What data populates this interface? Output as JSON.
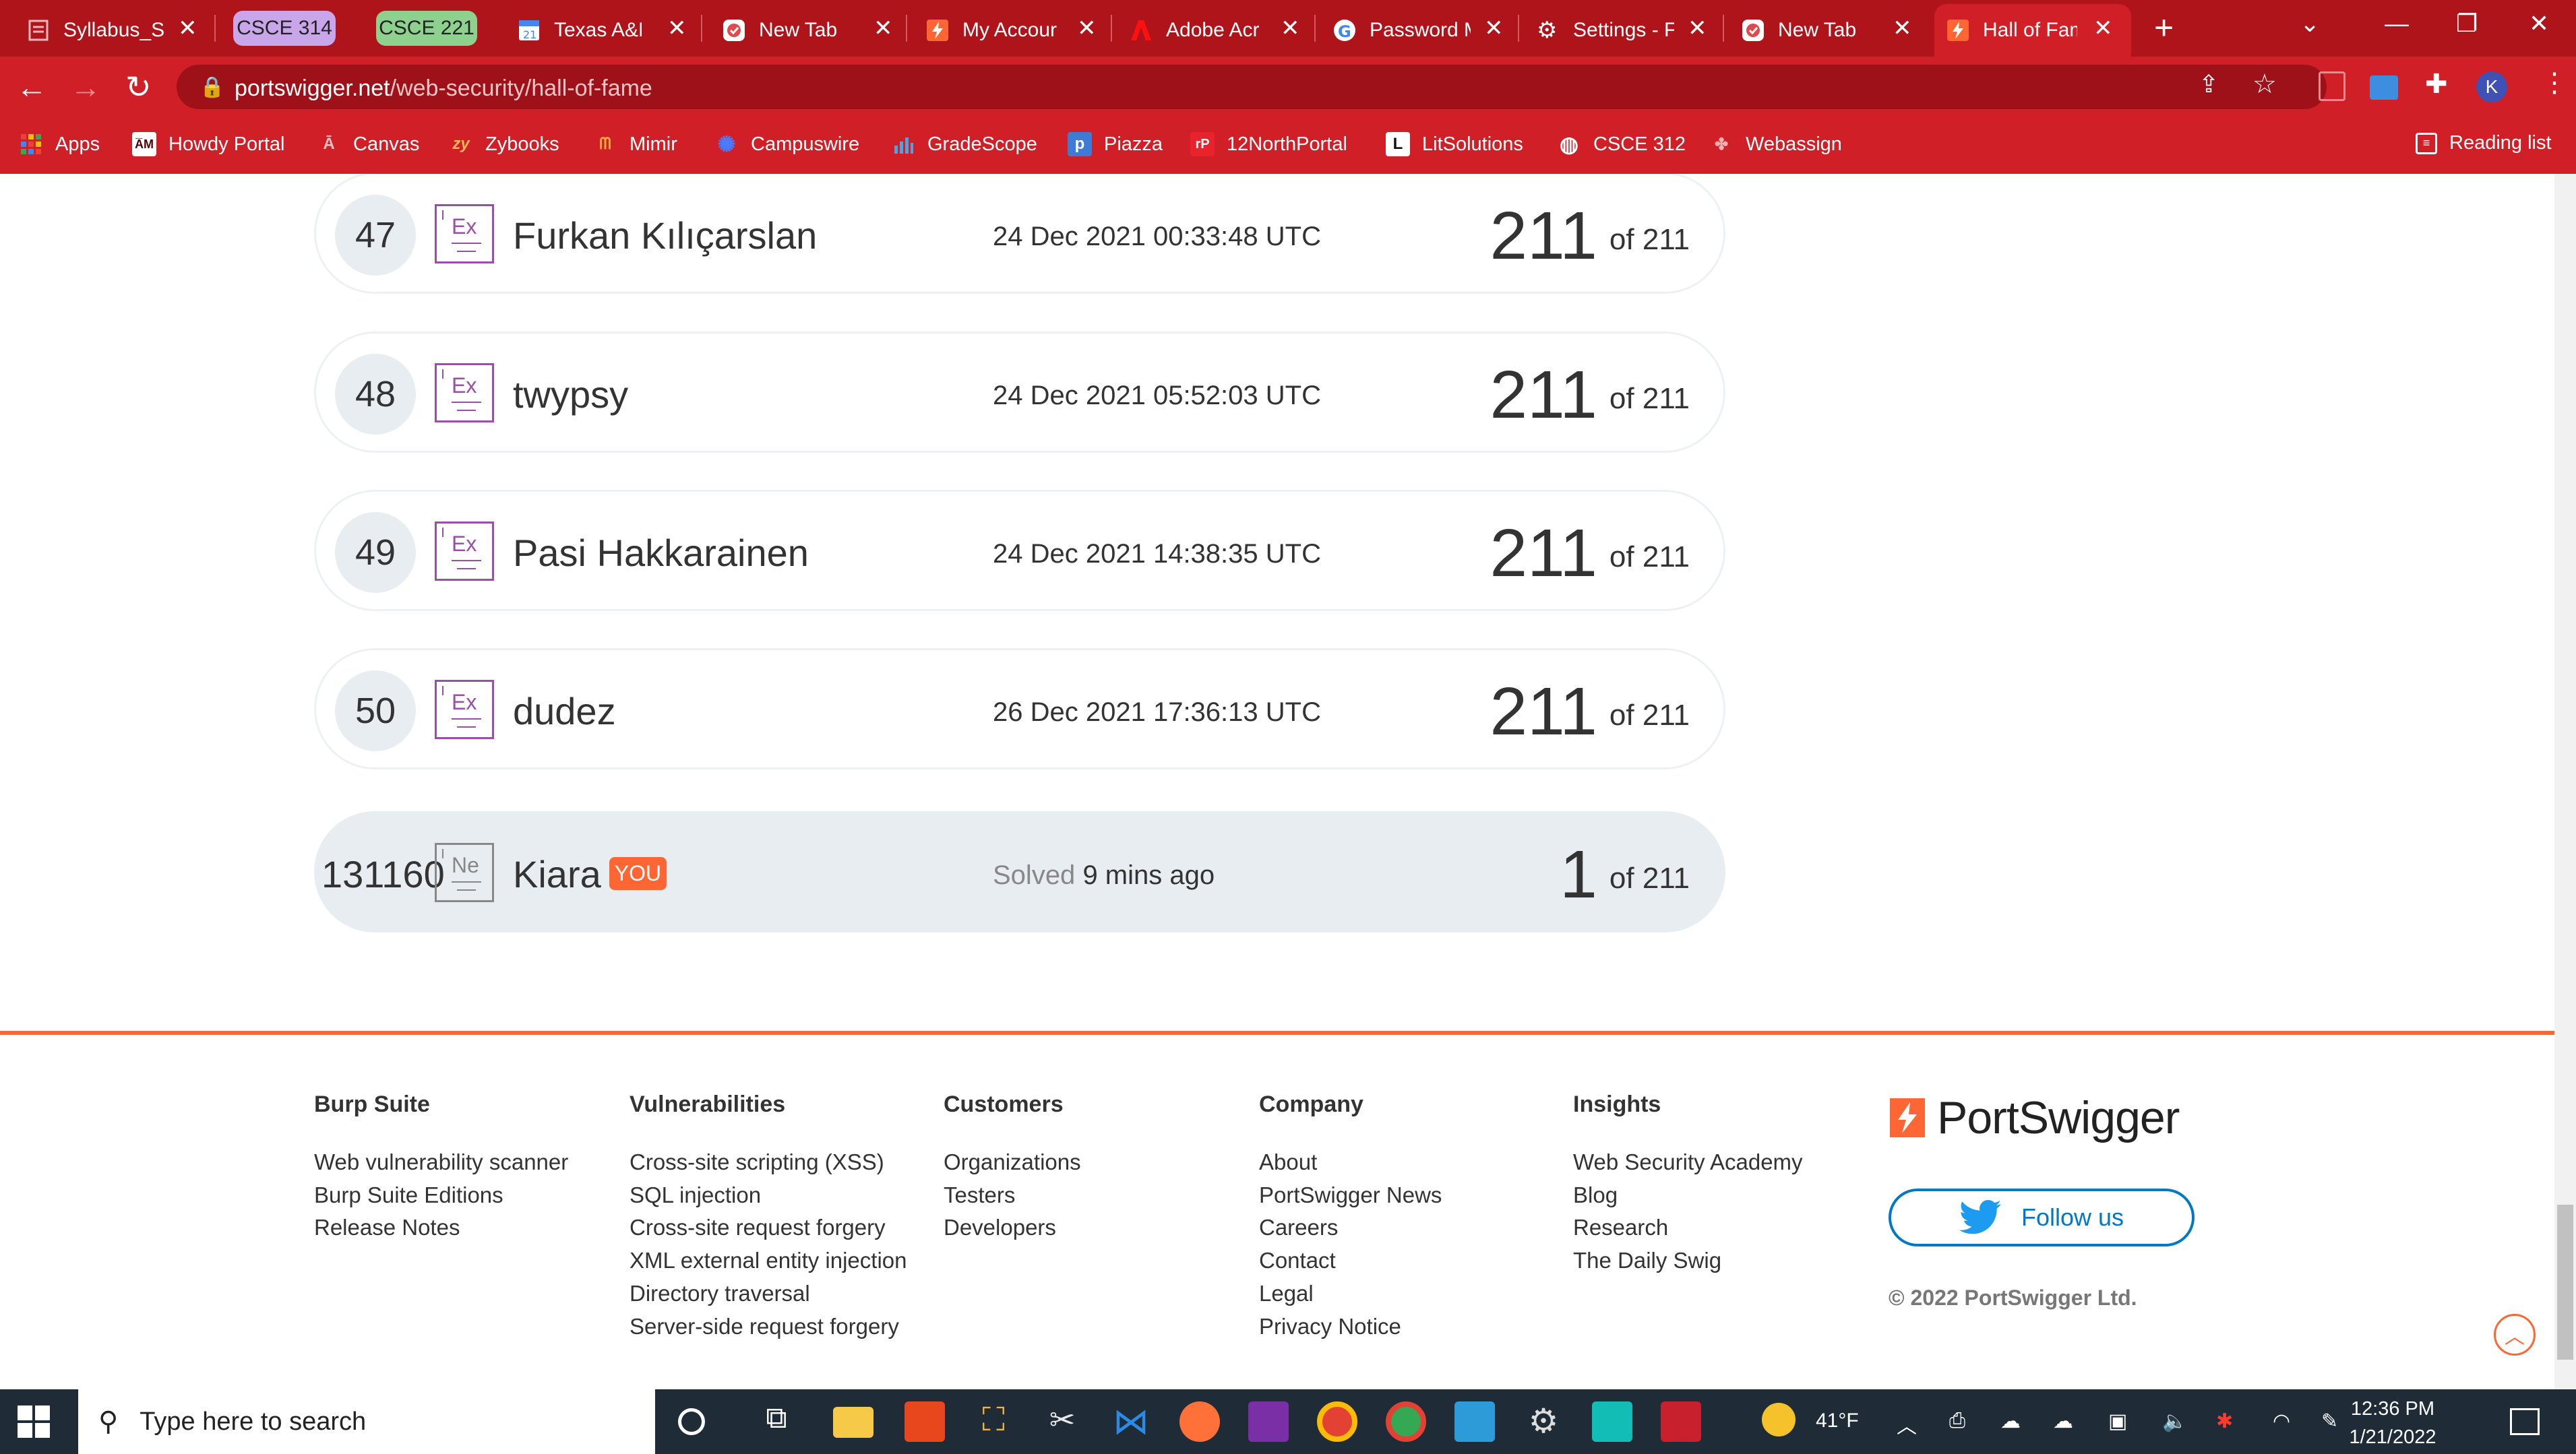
{
  "browser": {
    "tabs": [
      {
        "title": "Syllabus_S",
        "icon": "document-icon"
      },
      {
        "title": "CSCE 314",
        "group": true,
        "color": "#c9a6ea"
      },
      {
        "title": "CSCE 221",
        "group": true,
        "color": "#8ed18e"
      },
      {
        "title": "Texas A&M",
        "icon": "calendar-icon"
      },
      {
        "title": "New Tab",
        "icon": "checkmark-icon"
      },
      {
        "title": "My Accour",
        "icon": "portswigger-icon"
      },
      {
        "title": "Adobe Acr",
        "icon": "adobe-icon"
      },
      {
        "title": "Password M",
        "icon": "google-icon"
      },
      {
        "title": "Settings - F",
        "icon": "gear-icon"
      },
      {
        "title": "New Tab",
        "icon": "checkmark-icon"
      },
      {
        "title": "Hall of Fam",
        "icon": "portswigger-icon",
        "active": true
      }
    ],
    "url_domain": "portswigger.net",
    "url_path": "/web-security/hall-of-fame",
    "profile_initial": "K",
    "bookmarks": [
      {
        "label": "Apps"
      },
      {
        "label": "Howdy Portal"
      },
      {
        "label": "Canvas"
      },
      {
        "label": "Zybooks"
      },
      {
        "label": "Mimir"
      },
      {
        "label": "Campuswire"
      },
      {
        "label": "GradeScope"
      },
      {
        "label": "Piazza"
      },
      {
        "label": "12NorthPortal"
      },
      {
        "label": "LitSolutions"
      },
      {
        "label": "CSCE 312"
      },
      {
        "label": "Webassign"
      }
    ],
    "reading_list": "Reading list"
  },
  "leaderboard": {
    "rows": [
      {
        "rank": "47",
        "badge": "Ex",
        "name": "Furkan Kılıçarslan",
        "time": "24 Dec 2021 00:33:48 UTC",
        "score": "211",
        "of": "of 211"
      },
      {
        "rank": "48",
        "badge": "Ex",
        "name": "twypsy",
        "time": "24 Dec 2021 05:52:03 UTC",
        "score": "211",
        "of": "of 211"
      },
      {
        "rank": "49",
        "badge": "Ex",
        "name": "Pasi Hakkarainen",
        "time": "24 Dec 2021 14:38:35 UTC",
        "score": "211",
        "of": "of 211"
      },
      {
        "rank": "50",
        "badge": "Ex",
        "name": "dudez",
        "time": "26 Dec 2021 17:36:13 UTC",
        "score": "211",
        "of": "of 211"
      }
    ],
    "you": {
      "rank": "131160",
      "badge": "Ne",
      "name": "Kiara",
      "tag": "YOU",
      "solved_label": "Solved",
      "time": "9 mins ago",
      "score": "1",
      "of": "of 211"
    }
  },
  "footer": {
    "columns": [
      {
        "heading": "Burp Suite",
        "links": [
          "Web vulnerability scanner",
          "Burp Suite Editions",
          "Release Notes"
        ]
      },
      {
        "heading": "Vulnerabilities",
        "links": [
          "Cross-site scripting (XSS)",
          "SQL injection",
          "Cross-site request forgery",
          "XML external entity injection",
          "Directory traversal",
          "Server-side request forgery"
        ]
      },
      {
        "heading": "Customers",
        "links": [
          "Organizations",
          "Testers",
          "Developers"
        ]
      },
      {
        "heading": "Company",
        "links": [
          "About",
          "PortSwigger News",
          "Careers",
          "Contact",
          "Legal",
          "Privacy Notice"
        ]
      },
      {
        "heading": "Insights",
        "links": [
          "Web Security Academy",
          "Blog",
          "Research",
          "The Daily Swig"
        ]
      }
    ],
    "brand": "PortSwigger",
    "follow_label": "Follow us",
    "copyright": "© 2022 PortSwigger Ltd."
  },
  "taskbar": {
    "search_placeholder": "Type here to search",
    "weather": "41°F",
    "time": "12:36 PM",
    "date": "1/21/2022"
  },
  "colors": {
    "chrome_red": "#d11f27",
    "accent_orange": "#ff6633",
    "badge_purple": "#9a4fa8",
    "twitter_blue": "#0078c8"
  }
}
